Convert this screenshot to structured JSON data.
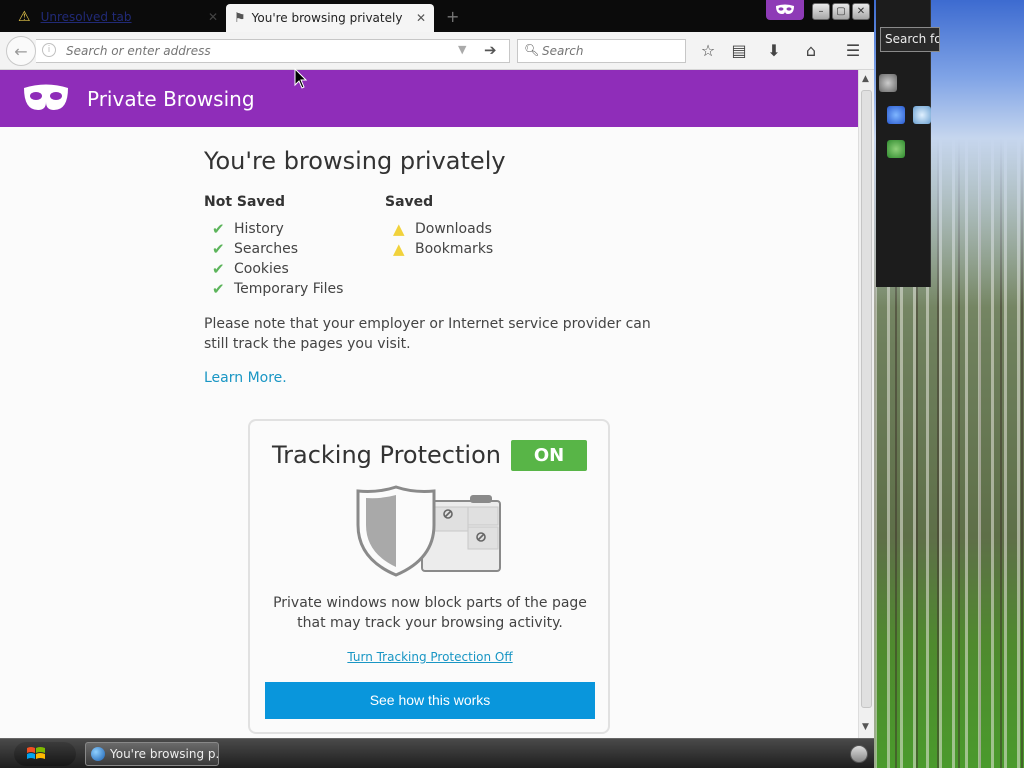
{
  "tabs": {
    "inactive": {
      "label": "Unresolved tab"
    },
    "active": {
      "label": "You're browsing privately"
    },
    "new_tab": "+"
  },
  "navbar": {
    "url_placeholder": "Search or enter address",
    "search_placeholder": "Search"
  },
  "header": {
    "title": "Private Browsing"
  },
  "main": {
    "heading": "You're browsing privately",
    "not_saved": {
      "heading": "Not Saved",
      "items": [
        "History",
        "Searches",
        "Cookies",
        "Temporary Files"
      ]
    },
    "saved": {
      "heading": "Saved",
      "items": [
        "Downloads",
        "Bookmarks"
      ]
    },
    "note": "Please note that your employer or Internet service provider can still track the pages you visit.",
    "learn_more": "Learn More."
  },
  "tracking": {
    "title": "Tracking Protection",
    "status": "ON",
    "description": "Private windows now block parts of the page that may track your browsing activity.",
    "turn_off_link": "Turn Tracking Protection Off",
    "see_how_button": "See how this works"
  },
  "taskbar": {
    "task_label": "You're browsing p..."
  },
  "desktop": {
    "search_label": "Search fo"
  },
  "colors": {
    "private_purple": "#8f2db9",
    "on_green": "#58b547",
    "button_blue": "#0996dc",
    "link_blue": "#1996c4",
    "check_green": "#5cb45b",
    "warning_yellow": "#f1d23c"
  }
}
